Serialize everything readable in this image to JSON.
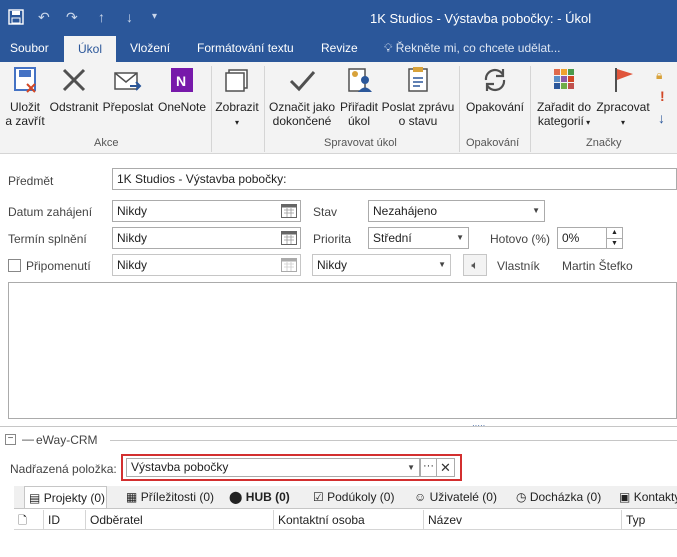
{
  "window": {
    "title": "1K Studios - Výstavba pobočky:  - Úkol"
  },
  "quick_access": {
    "save_icon": "save-icon",
    "undo_icon": "undo-icon",
    "redo_icon": "redo-icon",
    "up_icon": "up-arrow-icon",
    "down_icon": "down-arrow-icon",
    "customize_icon": "customize-icon"
  },
  "tabs": [
    {
      "label": "Soubor"
    },
    {
      "label": "Úkol"
    },
    {
      "label": "Vložení"
    },
    {
      "label": "Formátování textu"
    },
    {
      "label": "Revize"
    }
  ],
  "tell_me": {
    "placeholder": "Řekněte mi, co chcete udělat..."
  },
  "ribbon": {
    "groups": [
      {
        "label": "Akce"
      },
      {
        "label": "Spravovat úkol"
      },
      {
        "label": "Opakování"
      },
      {
        "label": "Značky"
      }
    ],
    "buttons": [
      {
        "line1": "Uložit",
        "line2": "a zavřít"
      },
      {
        "line1": "Odstranit",
        "line2": ""
      },
      {
        "line1": "Přeposlat",
        "line2": ""
      },
      {
        "line1": "OneNote",
        "line2": ""
      },
      {
        "line1": "Zobrazit",
        "line2": ""
      },
      {
        "line1": "Označit jako",
        "line2": "dokončené"
      },
      {
        "line1": "Přiřadit",
        "line2": "úkol"
      },
      {
        "line1": "Poslat zprávu",
        "line2": "o stavu"
      },
      {
        "line1": "Opakování",
        "line2": ""
      },
      {
        "line1": "Zařadit do",
        "line2": "kategorií"
      },
      {
        "line1": "Zpracovat",
        "line2": ""
      }
    ]
  },
  "form": {
    "subject_label": "Předmět",
    "subject_value": "1K Studios - Výstavba pobočky:",
    "start_label": "Datum zahájení",
    "start_value": "Nikdy",
    "due_label": "Termín splnění",
    "due_value": "Nikdy",
    "reminder_label": "Připomenutí",
    "reminder_date": "Nikdy",
    "reminder_time": "Nikdy",
    "status_label": "Stav",
    "status_value": "Nezahájeno",
    "priority_label": "Priorita",
    "priority_value": "Střední",
    "complete_label": "Hotovo (%)",
    "complete_value": "0%",
    "owner_label": "Vlastník",
    "owner_value": "Martin Štefko"
  },
  "eway": {
    "header": "eWay-CRM",
    "parent_label": "Nadřazená položka:",
    "parent_value": "Výstavba pobočky",
    "tabs": [
      {
        "label": "Projekty (0)"
      },
      {
        "label": "Příležitosti (0)"
      },
      {
        "label": "HUB (0)"
      },
      {
        "label": "Podúkoly (0)"
      },
      {
        "label": "Uživatelé (0)"
      },
      {
        "label": "Docházka (0)"
      },
      {
        "label": "Kontakty"
      }
    ],
    "columns": [
      {
        "label": ""
      },
      {
        "label": "ID"
      },
      {
        "label": "Odběratel"
      },
      {
        "label": "Kontaktní osoba"
      },
      {
        "label": "Název"
      },
      {
        "label": "Typ"
      }
    ]
  }
}
